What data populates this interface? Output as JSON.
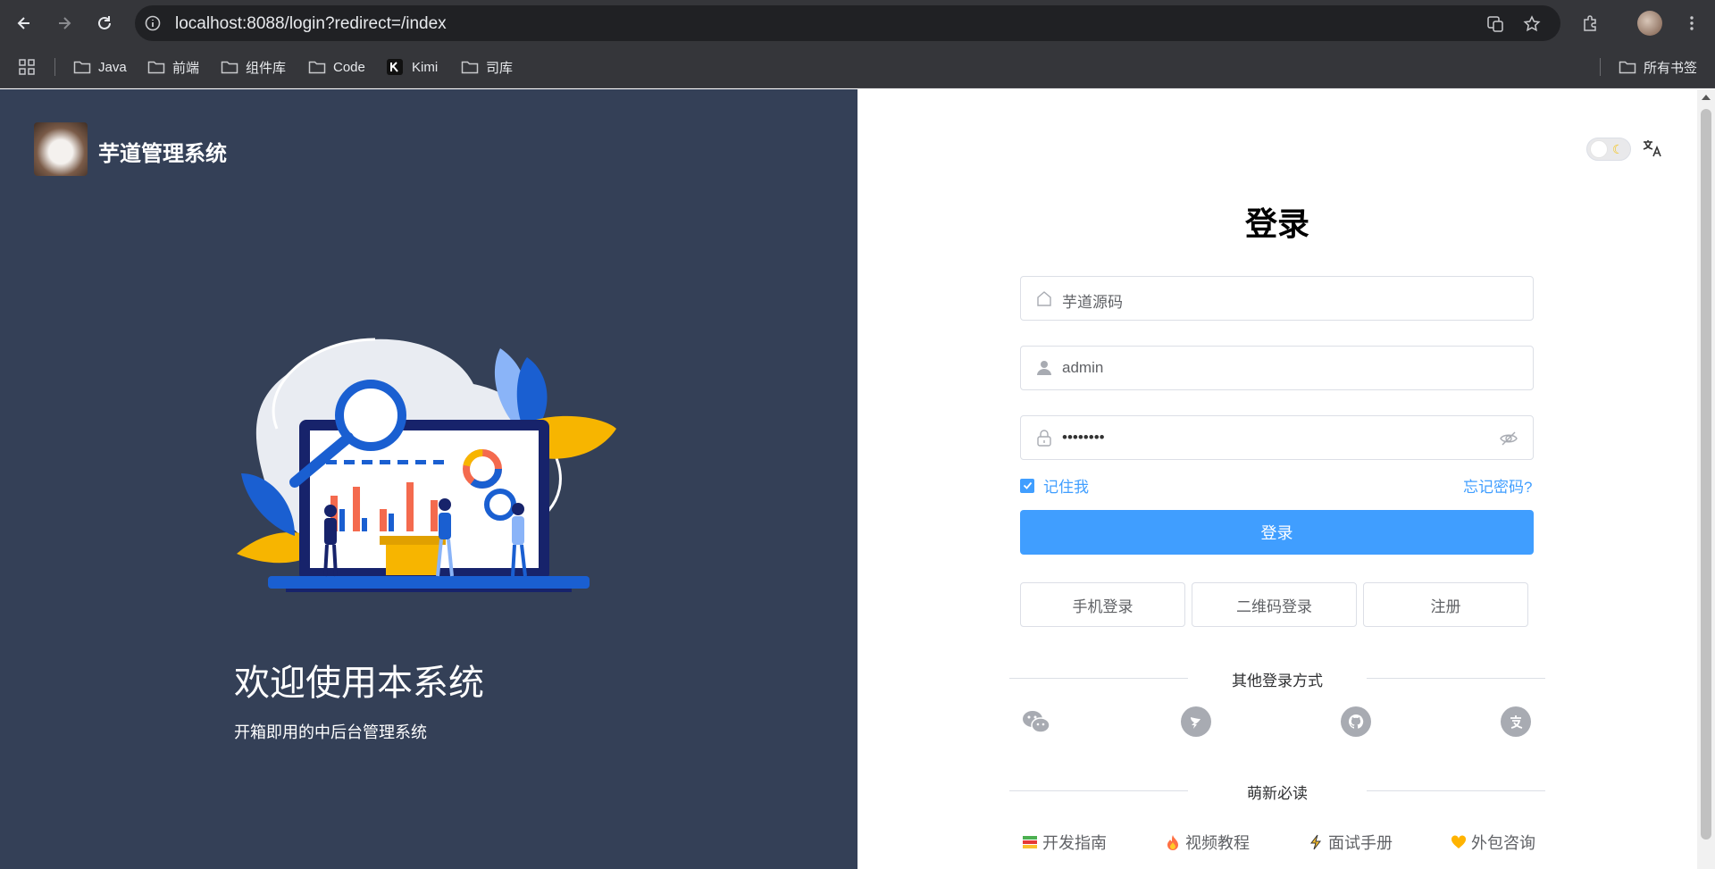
{
  "browser": {
    "url": "localhost:8088/login?redirect=/index",
    "bookmarks": [
      "Java",
      "前端",
      "组件库",
      "Code",
      "Kimi",
      "司库"
    ],
    "all_bookmarks": "所有书签"
  },
  "left": {
    "brand": "芋道管理系统",
    "welcome": "欢迎使用本系统",
    "subtitle": "开箱即用的中后台管理系统"
  },
  "login": {
    "title": "登录",
    "tenant": "芋道源码",
    "username": "admin",
    "password": "••••••••",
    "remember": "记住我",
    "forgot": "忘记密码?",
    "submit": "登录",
    "alt": [
      "手机登录",
      "二维码登录",
      "注册"
    ],
    "other_title": "其他登录方式",
    "social_icons": [
      "wechat-icon",
      "dingtalk-icon",
      "github-icon",
      "alipay-icon"
    ],
    "news_title": "萌新必读",
    "links": [
      "开发指南",
      "视频教程",
      "面试手册",
      "外包咨询"
    ]
  }
}
